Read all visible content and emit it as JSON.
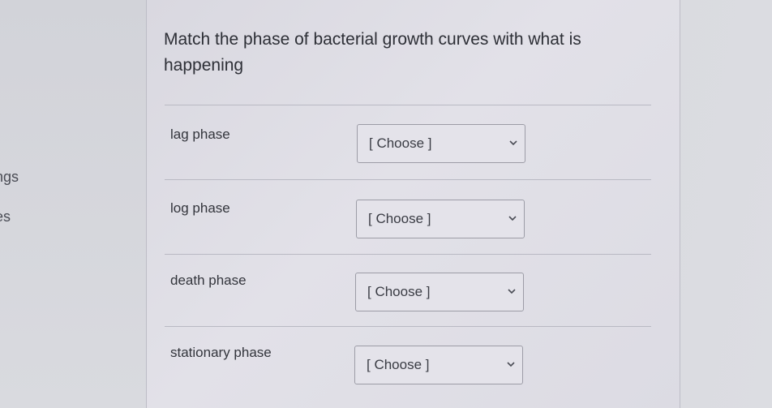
{
  "sidebar": {
    "items": [
      {
        "label": "ngs"
      },
      {
        "label": "es"
      }
    ]
  },
  "question": {
    "text": "Match the phase of bacterial growth curves with what is happening",
    "matches": [
      {
        "prompt": "lag phase",
        "selected": "[ Choose ]",
        "icon": "chevron-down-icon"
      },
      {
        "prompt": "log phase",
        "selected": "[ Choose ]",
        "icon": "chevron-down-icon"
      },
      {
        "prompt": "death phase",
        "selected": "[ Choose ]",
        "icon": "chevron-down-icon"
      },
      {
        "prompt": "stationary phase",
        "selected": "[ Choose ]",
        "icon": "chevron-down-icon"
      }
    ]
  },
  "colors": {
    "background": "#d6d7dc",
    "panel": "#e2e1e8",
    "text": "#2d2f36",
    "border": "#9c9ca6"
  }
}
